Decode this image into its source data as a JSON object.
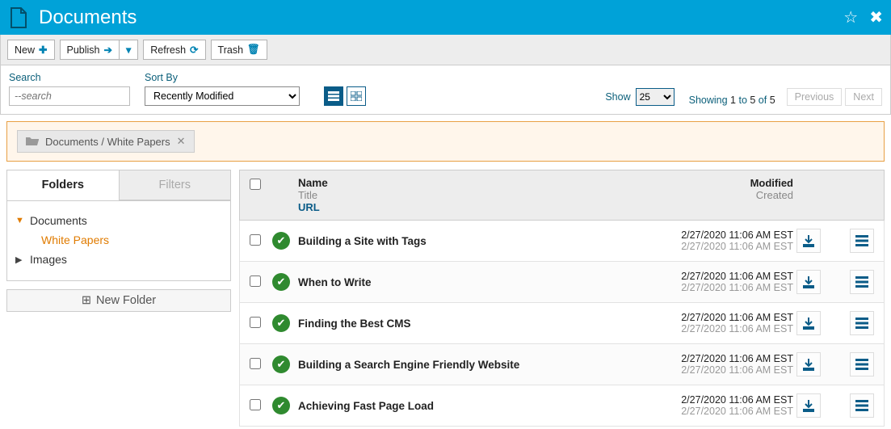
{
  "header": {
    "title": "Documents"
  },
  "toolbar": {
    "new": "New",
    "publish": "Publish",
    "refresh": "Refresh",
    "trash": "Trash"
  },
  "filterbar": {
    "search_label": "Search",
    "search_placeholder": "--search",
    "sort_label": "Sort By",
    "sort_value": "Recently Modified",
    "show_label": "Show",
    "show_value": "25",
    "showing_prefix": "Showing ",
    "showing_from": "1",
    "showing_to_word": " to ",
    "showing_to": "5",
    "showing_of_word": " of ",
    "showing_total": "5",
    "previous": "Previous",
    "next": "Next"
  },
  "breadcrumb": {
    "path": "Documents / White Papers"
  },
  "tabs": {
    "folders": "Folders",
    "filters": "Filters"
  },
  "tree": {
    "root1": "Documents",
    "child1": "White Papers",
    "root2": "Images",
    "newfolder": "New Folder"
  },
  "columns": {
    "name": "Name",
    "title": "Title",
    "url": "URL",
    "modified": "Modified",
    "created": "Created"
  },
  "rows": [
    {
      "name": "Building a Site with Tags",
      "modified": "2/27/2020 11:06 AM EST",
      "created": "2/27/2020 11:06 AM EST"
    },
    {
      "name": "When to Write",
      "modified": "2/27/2020 11:06 AM EST",
      "created": "2/27/2020 11:06 AM EST"
    },
    {
      "name": "Finding the Best CMS",
      "modified": "2/27/2020 11:06 AM EST",
      "created": "2/27/2020 11:06 AM EST"
    },
    {
      "name": "Building a Search Engine Friendly Website",
      "modified": "2/27/2020 11:06 AM EST",
      "created": "2/27/2020 11:06 AM EST"
    },
    {
      "name": "Achieving Fast Page Load",
      "modified": "2/27/2020 11:06 AM EST",
      "created": "2/27/2020 11:06 AM EST"
    }
  ]
}
